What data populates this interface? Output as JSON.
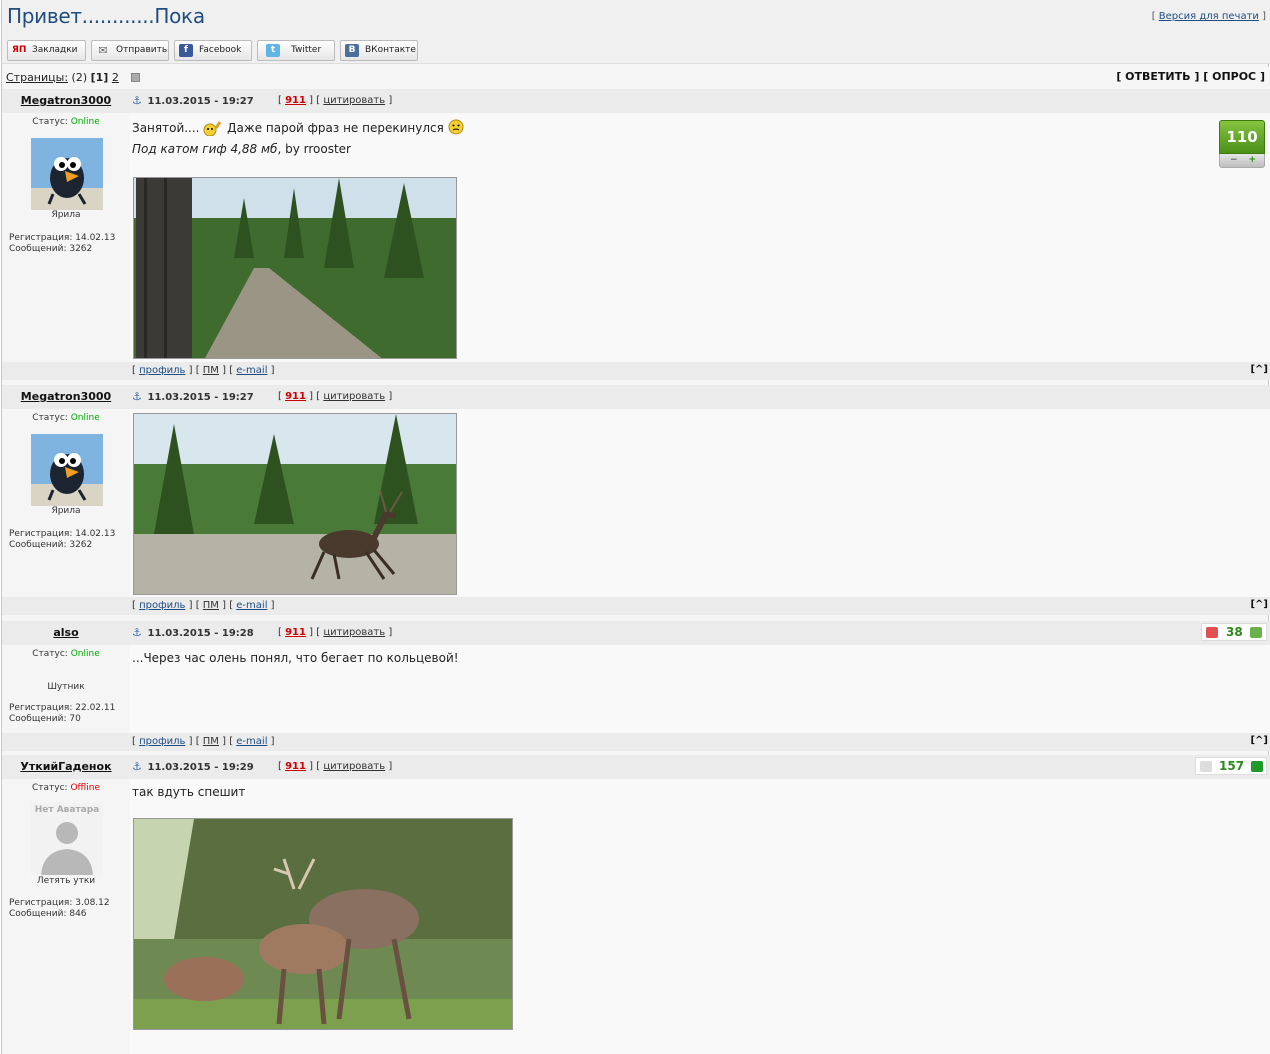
{
  "header": {
    "title": "Привет............Пока",
    "print_open": "[ ",
    "print_label": "Версия для печати",
    "print_close": " ]"
  },
  "share": [
    {
      "label": "Закладки",
      "icon": "yap-icon",
      "icon_text": "ЯП"
    },
    {
      "label": "Отправить",
      "icon": "mail-icon",
      "icon_text": "✉"
    },
    {
      "label": "Facebook",
      "icon": "facebook-icon",
      "icon_text": "f"
    },
    {
      "label": "Twitter",
      "icon": "twitter-icon",
      "icon_text": "t"
    },
    {
      "label": "ВКонтакте",
      "icon": "vk-icon",
      "icon_text": "В"
    }
  ],
  "pagination": {
    "label": "Страницы:",
    "total": "(2)",
    "current": "[1]",
    "next": "2"
  },
  "actions": {
    "reply": "[ ОТВЕТИТЬ ]",
    "poll": "[ ОПРОС ]"
  },
  "common": {
    "status_label": "Статус:",
    "reg_label": "Регистрация:",
    "posts_label": "Сообщений:",
    "profile": "профиль",
    "pm": "ПМ",
    "email": "e-mail",
    "quote": "цитировать",
    "totop": "[^]",
    "sep": " ] [ ",
    "br_open": "[ ",
    "br_close": " ]",
    "anchor_glyph": "⚓"
  },
  "posts": [
    {
      "author": "Megatron3000",
      "date": "11.03.2015 - 19:27",
      "ref_num": "911",
      "status": "Online",
      "rank": "Ярила",
      "reg_date": "14.02.13",
      "post_count": "3262",
      "text_1": "Занятой....",
      "text_2": "Даже парой фраз не перекинулся",
      "text_italic": "Под катом гиф 4,88 мб",
      "text_by": ", by rrooster",
      "rating": "110",
      "rating_minus": "−",
      "rating_plus": "+"
    },
    {
      "author": "Megatron3000",
      "date": "11.03.2015 - 19:27",
      "ref_num": "911",
      "status": "Online",
      "rank": "Ярила",
      "reg_date": "14.02.13",
      "post_count": "3262"
    },
    {
      "author": "also",
      "date": "11.03.2015 - 19:28",
      "ref_num": "911",
      "status": "Online",
      "rank": "Шутник",
      "reg_date": "22.02.11",
      "post_count": "70",
      "text": "...Через час олень понял, что бегает по кольцевой!",
      "rating": "38"
    },
    {
      "author": "УткийГаденок",
      "date": "11.03.2015 - 19:29",
      "ref_num": "911",
      "status": "Offline",
      "rank": "Летять утки",
      "avatar_text": "Нет Аватара",
      "reg_date": "3.08.12",
      "post_count": "846",
      "text": "так вдуть спешит",
      "rating": "157"
    }
  ],
  "colors": {
    "title": "#1f4d80",
    "online": "#00aa00",
    "offline": "#dd0000",
    "ref": "#cc0000",
    "rating_green": "#4b8f18"
  }
}
